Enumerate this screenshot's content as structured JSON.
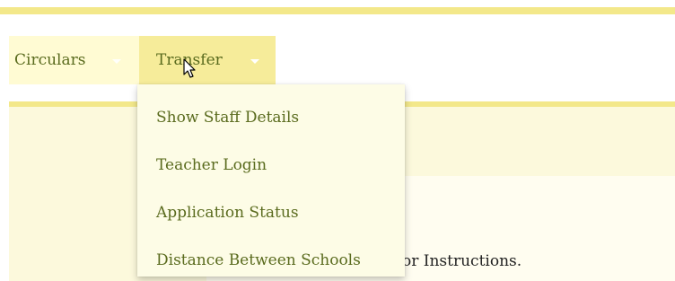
{
  "nav": {
    "items": [
      {
        "label": "Circulars"
      },
      {
        "label": "Transfer"
      }
    ]
  },
  "transfer_menu": {
    "items": [
      {
        "label": "Show Staff Details"
      },
      {
        "label": "Teacher Login"
      },
      {
        "label": "Application Status"
      },
      {
        "label": "Distance Between Schools"
      }
    ]
  },
  "content": {
    "partial_text": "or Instructions."
  },
  "colors": {
    "accent_stripe": "#f3e88a",
    "nav_active_bg": "#f6ec9a",
    "nav_bg": "#fffbd3",
    "link_text": "#5a6b1e",
    "dropdown_bg": "#fdfce6"
  },
  "icons": [
    "chevron-down-icon",
    "mouse-pointer-icon"
  ]
}
